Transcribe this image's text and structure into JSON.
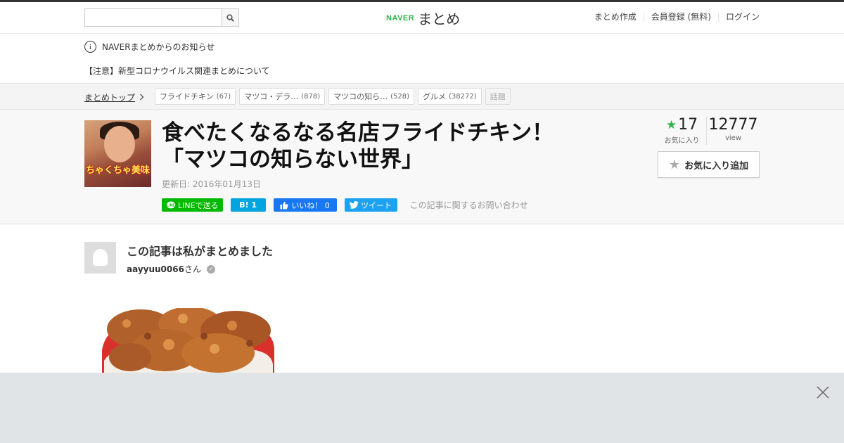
{
  "header": {
    "search": {
      "value": "",
      "placeholder": ""
    },
    "logo": {
      "brand": "NAVER",
      "product": "まとめ"
    },
    "nav": [
      "まとめ作成",
      "会員登録 (無料)",
      "ログイン"
    ]
  },
  "notice": {
    "title": "NAVERまとめからのお知らせ",
    "item": "【注意】新型コロナウイルス関連まとめについて"
  },
  "breadcrumb": {
    "top_label": "まとめトップ",
    "tags": [
      {
        "label": "フライドチキン",
        "count": "(67)"
      },
      {
        "label": "マツコ・デラ…",
        "count": "(878)"
      },
      {
        "label": "マツコの知ら…",
        "count": "(528)"
      },
      {
        "label": "グルメ",
        "count": "(38272)"
      }
    ],
    "topic_label": "話題"
  },
  "article": {
    "thumb_caption": "ちゃくちゃ美味",
    "title": "食べたくなるなる名店フライドチキン！　「マツコの知らない世界」",
    "updated": "更新日: 2016年01月13日",
    "share": {
      "line": "LINEで送る",
      "hatena": "B! 1",
      "facebook": "いいね！ 0",
      "twitter": "ツイート"
    },
    "inquiry": "この記事に関するお問い合わせ",
    "favorites_count": "17",
    "favorites_label": "お気に入り",
    "views_count": "12777",
    "views_label": "view",
    "fav_button": "お気に入り追加"
  },
  "author": {
    "heading": "この記事は私がまとめました",
    "name": "aayyuu0066",
    "suffix": "さん"
  },
  "colors": {
    "brand_green": "#2fb34a",
    "line": "#00b900",
    "hatena": "#00a4de",
    "facebook": "#1877f2",
    "twitter": "#1da1f2"
  }
}
